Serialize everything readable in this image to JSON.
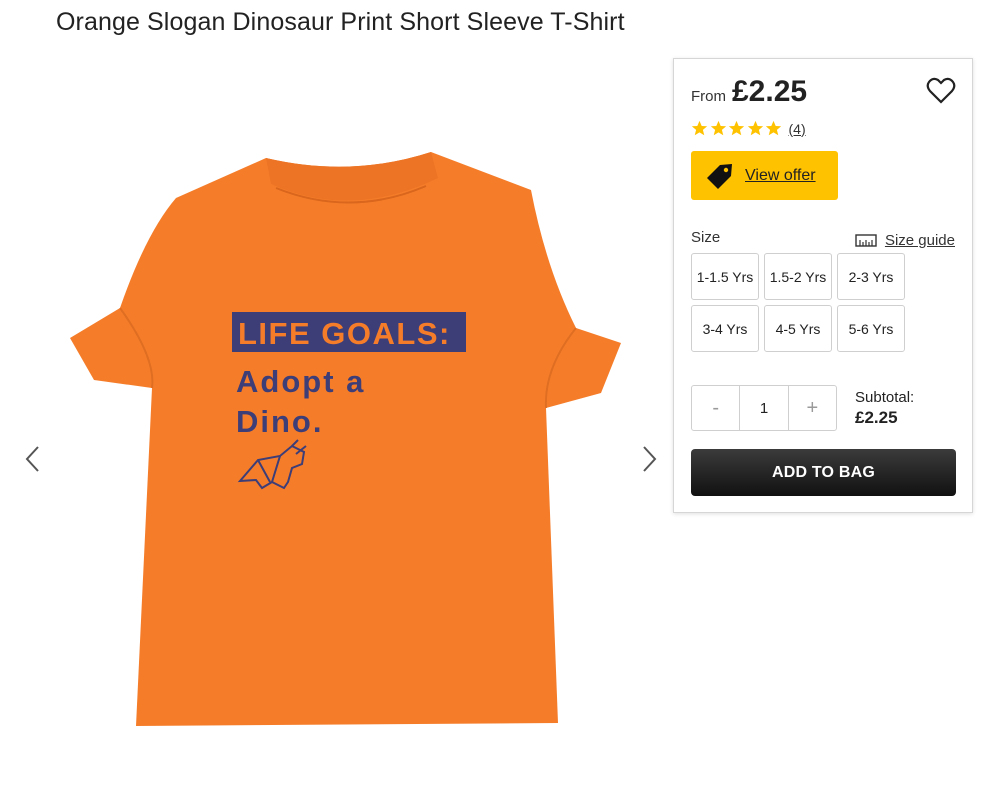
{
  "product": {
    "title": "Orange Slogan Dinosaur Print Short Sleeve T-Shirt",
    "image": {
      "print_line1": "LIFE GOALS:",
      "print_line2": "Adopt a",
      "print_line3": "Dino."
    }
  },
  "panel": {
    "price_prefix": "From",
    "price": "£2.25",
    "rating": {
      "stars": 5,
      "review_count": "(4)"
    },
    "offer_label": "View offer",
    "size_label": "Size",
    "size_guide_label": "Size guide",
    "sizes": [
      "1-1.5 Yrs",
      "1.5-2 Yrs",
      "2-3 Yrs",
      "3-4 Yrs",
      "4-5 Yrs",
      "5-6 Yrs"
    ],
    "quantity": {
      "minus": "-",
      "value": "1",
      "plus": "+"
    },
    "subtotal_label": "Subtotal:",
    "subtotal_value": "£2.25",
    "add_to_bag_label": "ADD TO BAG"
  },
  "colors": {
    "shirt": "#f57d2a",
    "print": "#3d3d78",
    "offer": "#ffc200",
    "star": "#ffc200"
  }
}
